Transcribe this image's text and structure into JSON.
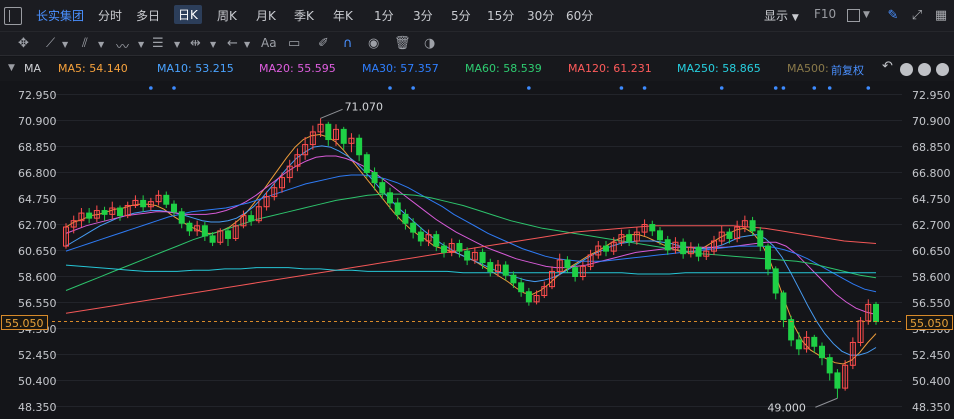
{
  "toolbar": {
    "stock_name": "长实集团",
    "periods": [
      "分时",
      "多日",
      "日K",
      "周K",
      "月K",
      "季K",
      "年K",
      "1分",
      "3分",
      "5分",
      "15分",
      "30分",
      "60分"
    ],
    "active_period": "日K",
    "display_label": "显示",
    "f10_label": "F10"
  },
  "indicator_bar": {
    "name": "MA",
    "items": [
      {
        "label": "MA5: 54.140",
        "color": "#f7a23c"
      },
      {
        "label": "MA10: 53.215",
        "color": "#4aa3ff"
      },
      {
        "label": "MA20: 55.595",
        "color": "#e05ee0"
      },
      {
        "label": "MA30: 57.357",
        "color": "#2f7fff"
      },
      {
        "label": "MA60: 58.539",
        "color": "#2ecc71"
      },
      {
        "label": "MA120: 61.231",
        "color": "#ff5b5b"
      },
      {
        "label": "MA250: 58.865",
        "color": "#27d0e0"
      },
      {
        "label": "MA500:",
        "color": "#8a7a4a"
      }
    ],
    "fuquan_label": "前复权"
  },
  "chart_data": {
    "type": "candlestick",
    "ylim": [
      48.35,
      72.95
    ],
    "y_ticks": [
      "72.950",
      "70.900",
      "68.850",
      "66.800",
      "64.750",
      "62.700",
      "60.650",
      "58.600",
      "56.550",
      "54.500",
      "52.450",
      "50.400",
      "48.350"
    ],
    "current_price": "55.050",
    "max_annotation": "71.070",
    "min_annotation": "49.000",
    "max_value": 71.07,
    "min_value": 49.0,
    "up_color": "#ff4d4d",
    "down_color": "#1fd046",
    "candles": [
      [
        61.0,
        62.5,
        62.8,
        60.8
      ],
      [
        62.5,
        63.0,
        63.4,
        62.0
      ],
      [
        63.0,
        63.6,
        64.0,
        62.5
      ],
      [
        63.6,
        63.2,
        64.0,
        62.8
      ],
      [
        63.2,
        63.8,
        64.2,
        62.9
      ],
      [
        63.8,
        63.5,
        64.1,
        63.0
      ],
      [
        63.5,
        64.0,
        64.5,
        63.1
      ],
      [
        64.0,
        63.4,
        64.2,
        63.0
      ],
      [
        63.4,
        64.2,
        64.5,
        63.2
      ],
      [
        64.2,
        64.6,
        65.0,
        64.0
      ],
      [
        64.6,
        64.1,
        65.0,
        63.7
      ],
      [
        64.1,
        64.5,
        64.8,
        63.8
      ],
      [
        64.5,
        65.0,
        65.4,
        64.2
      ],
      [
        65.0,
        64.3,
        65.3,
        64.0
      ],
      [
        64.3,
        63.7,
        64.6,
        63.4
      ],
      [
        63.7,
        62.8,
        64.0,
        62.4
      ],
      [
        62.8,
        62.2,
        63.0,
        61.8
      ],
      [
        62.2,
        62.6,
        63.0,
        61.8
      ],
      [
        62.6,
        61.8,
        62.9,
        61.4
      ],
      [
        61.8,
        61.3,
        62.1,
        61.0
      ],
      [
        61.3,
        62.2,
        62.4,
        61.1
      ],
      [
        62.2,
        61.6,
        62.5,
        61.0
      ],
      [
        61.6,
        62.6,
        63.0,
        61.4
      ],
      [
        62.6,
        63.4,
        63.8,
        62.4
      ],
      [
        63.4,
        63.0,
        63.8,
        62.6
      ],
      [
        63.0,
        64.1,
        64.6,
        62.8
      ],
      [
        64.1,
        64.9,
        65.3,
        63.8
      ],
      [
        64.9,
        65.6,
        66.0,
        64.6
      ],
      [
        65.6,
        66.4,
        66.8,
        65.2
      ],
      [
        66.4,
        67.3,
        67.8,
        66.0
      ],
      [
        67.3,
        68.2,
        68.7,
        66.9
      ],
      [
        68.2,
        69.0,
        69.6,
        67.8
      ],
      [
        69.0,
        70.0,
        70.5,
        68.6
      ],
      [
        70.0,
        70.6,
        71.07,
        69.6
      ],
      [
        70.6,
        69.4,
        70.8,
        68.9
      ],
      [
        69.4,
        70.2,
        70.6,
        68.9
      ],
      [
        70.2,
        69.1,
        70.4,
        68.6
      ],
      [
        69.1,
        69.5,
        69.9,
        68.4
      ],
      [
        69.5,
        68.2,
        69.8,
        67.7
      ],
      [
        68.2,
        66.8,
        68.4,
        66.4
      ],
      [
        66.8,
        66.0,
        67.2,
        65.4
      ],
      [
        66.0,
        65.2,
        66.4,
        64.7
      ],
      [
        65.2,
        64.4,
        65.6,
        63.9
      ],
      [
        64.4,
        63.5,
        64.8,
        63.1
      ],
      [
        63.5,
        62.8,
        63.9,
        62.3
      ],
      [
        62.8,
        62.1,
        63.2,
        61.6
      ],
      [
        62.1,
        61.4,
        62.5,
        61.0
      ],
      [
        61.4,
        61.9,
        62.3,
        61.0
      ],
      [
        61.9,
        61.0,
        62.2,
        60.6
      ],
      [
        61.0,
        60.5,
        61.3,
        60.1
      ],
      [
        60.5,
        61.2,
        61.6,
        60.2
      ],
      [
        61.2,
        60.6,
        61.5,
        60.1
      ],
      [
        60.6,
        59.9,
        60.9,
        59.5
      ],
      [
        59.9,
        60.5,
        60.9,
        59.6
      ],
      [
        60.5,
        59.7,
        60.8,
        59.2
      ],
      [
        59.7,
        59.0,
        60.0,
        58.6
      ],
      [
        59.0,
        59.5,
        59.9,
        58.6
      ],
      [
        59.5,
        58.7,
        59.8,
        58.3
      ],
      [
        58.7,
        58.1,
        59.0,
        57.7
      ],
      [
        58.1,
        57.4,
        58.5,
        57.0
      ],
      [
        57.4,
        56.6,
        57.7,
        56.3
      ],
      [
        56.6,
        57.1,
        57.5,
        56.4
      ],
      [
        57.1,
        57.8,
        58.2,
        56.9
      ],
      [
        57.8,
        59.0,
        59.4,
        57.6
      ],
      [
        59.0,
        59.9,
        60.4,
        58.7
      ],
      [
        59.9,
        59.3,
        60.2,
        58.9
      ],
      [
        59.3,
        58.6,
        59.6,
        58.2
      ],
      [
        58.6,
        59.4,
        59.8,
        58.3
      ],
      [
        59.4,
        60.3,
        60.7,
        59.1
      ],
      [
        60.3,
        61.0,
        61.4,
        60.0
      ],
      [
        61.0,
        60.6,
        61.4,
        60.2
      ],
      [
        60.6,
        61.3,
        61.7,
        60.3
      ],
      [
        61.3,
        61.9,
        62.3,
        61.0
      ],
      [
        61.9,
        61.4,
        62.3,
        61.0
      ],
      [
        61.4,
        62.1,
        62.5,
        61.1
      ],
      [
        62.1,
        62.7,
        63.1,
        61.8
      ],
      [
        62.7,
        62.2,
        63.0,
        61.8
      ],
      [
        62.2,
        61.5,
        62.5,
        61.1
      ],
      [
        61.5,
        60.7,
        61.8,
        60.3
      ],
      [
        60.7,
        61.3,
        61.7,
        60.4
      ],
      [
        61.3,
        60.4,
        61.6,
        60.0
      ],
      [
        60.4,
        60.9,
        61.3,
        60.1
      ],
      [
        60.9,
        60.2,
        61.2,
        59.8
      ],
      [
        60.2,
        60.6,
        61.0,
        59.9
      ],
      [
        60.6,
        61.4,
        61.8,
        60.3
      ],
      [
        61.4,
        62.1,
        62.6,
        61.1
      ],
      [
        62.1,
        61.6,
        62.4,
        61.2
      ],
      [
        61.6,
        62.5,
        63.0,
        61.3
      ],
      [
        62.5,
        63.0,
        63.4,
        62.1
      ],
      [
        63.0,
        62.2,
        63.3,
        61.8
      ],
      [
        62.2,
        61.0,
        62.5,
        60.6
      ],
      [
        61.0,
        59.2,
        61.2,
        58.7
      ],
      [
        59.2,
        57.3,
        59.4,
        56.8
      ],
      [
        57.3,
        55.2,
        57.5,
        54.6
      ],
      [
        55.2,
        53.6,
        55.5,
        53.1
      ],
      [
        53.6,
        52.9,
        54.2,
        52.4
      ],
      [
        52.9,
        53.8,
        54.3,
        52.6
      ],
      [
        53.8,
        53.1,
        54.0,
        52.6
      ],
      [
        53.1,
        52.2,
        53.4,
        51.6
      ],
      [
        52.2,
        51.0,
        52.5,
        50.4
      ],
      [
        51.0,
        49.8,
        51.3,
        49.0
      ],
      [
        49.8,
        51.6,
        52.0,
        49.6
      ],
      [
        51.6,
        53.4,
        53.8,
        51.3
      ],
      [
        53.4,
        55.1,
        55.4,
        53.1
      ],
      [
        55.1,
        56.4,
        56.8,
        54.8
      ],
      [
        56.4,
        55.05,
        56.6,
        54.8
      ]
    ],
    "ma_lines": [
      {
        "name": "MA5",
        "color": "#f7a23c",
        "values": [
          62.5,
          62.9,
          63.1,
          63.4,
          63.5,
          63.7,
          63.9,
          64.0,
          64.2,
          64.3,
          64.3,
          64.2,
          63.9,
          63.4,
          63.0,
          62.6,
          62.3,
          62.0,
          62.0,
          62.2,
          62.5,
          63.0,
          63.6,
          64.4,
          65.3,
          66.2,
          67.1,
          68.0,
          68.8,
          69.4,
          69.7,
          69.8,
          69.6,
          69.2,
          68.5,
          67.7,
          66.9,
          66.1,
          65.3,
          64.5,
          63.7,
          63.0,
          62.4,
          61.9,
          61.5,
          61.0,
          60.8,
          60.6,
          60.4,
          60.1,
          59.8,
          59.4,
          59.0,
          58.6,
          58.2,
          57.7,
          57.3,
          57.2,
          57.5,
          58.0,
          58.6,
          59.1,
          59.5,
          59.9,
          60.3,
          60.6,
          61.0,
          61.4,
          61.7,
          61.9,
          61.9,
          61.7,
          61.4,
          61.1,
          60.8,
          60.6,
          60.5,
          60.6,
          60.9,
          61.3,
          61.7,
          62.0,
          62.3,
          62.4,
          62.0,
          61.2,
          59.9,
          58.2,
          56.4,
          54.7,
          53.5,
          52.8,
          52.4,
          52.1,
          51.8,
          51.7,
          52.0,
          52.6,
          53.4,
          54.1
        ]
      },
      {
        "name": "MA10",
        "color": "#4aa3ff",
        "values": [
          61.0,
          61.4,
          61.8,
          62.2,
          62.6,
          62.9,
          63.2,
          63.4,
          63.6,
          63.7,
          63.8,
          63.8,
          63.7,
          63.6,
          63.4,
          63.2,
          63.0,
          62.9,
          62.9,
          63.0,
          63.2,
          63.6,
          64.1,
          64.8,
          65.6,
          66.4,
          67.2,
          67.9,
          68.4,
          68.8,
          68.9,
          68.8,
          68.5,
          68.1,
          67.6,
          66.9,
          66.2,
          65.4,
          64.7,
          64.0,
          63.4,
          62.8,
          62.2,
          61.7,
          61.2,
          60.8,
          60.4,
          60.1,
          59.8,
          59.5,
          59.2,
          58.9,
          58.7,
          58.5,
          58.3,
          58.2,
          58.3,
          58.5,
          58.8,
          59.2,
          59.6,
          60.0,
          60.4,
          60.7,
          61.0,
          61.2,
          61.3,
          61.4,
          61.4,
          61.4,
          61.3,
          61.2,
          61.0,
          60.9,
          60.8,
          60.8,
          60.9,
          61.1,
          61.4,
          61.7,
          61.8,
          61.9,
          61.6,
          61.0,
          60.1,
          58.9,
          57.6,
          56.3,
          55.1,
          54.1,
          53.3,
          52.7,
          52.4,
          52.4,
          52.6,
          53.0
        ]
      },
      {
        "name": "MA20",
        "color": "#e05ee0",
        "values": [
          62.0,
          62.3,
          62.6,
          62.8,
          63.0,
          63.2,
          63.4,
          63.5,
          63.6,
          63.7,
          63.7,
          63.6,
          63.5,
          63.5,
          63.5,
          63.6,
          63.8,
          64.1,
          64.5,
          65.0,
          65.6,
          66.2,
          66.8,
          67.3,
          67.7,
          68.0,
          68.1,
          68.1,
          67.9,
          67.6,
          67.2,
          66.7,
          66.1,
          65.5,
          64.9,
          64.3,
          63.7,
          63.1,
          62.6,
          62.1,
          61.7,
          61.3,
          60.9,
          60.6,
          60.3,
          60.0,
          59.8,
          59.6,
          59.4,
          59.3,
          59.3,
          59.4,
          59.5,
          59.7,
          59.9,
          60.1,
          60.3,
          60.5,
          60.6,
          60.7,
          60.8,
          60.9,
          60.9,
          60.9,
          60.9,
          60.9,
          60.9,
          61.0,
          61.1,
          61.2,
          61.3,
          61.3,
          61.0,
          60.4,
          59.6,
          58.8,
          58.0,
          57.2,
          56.6,
          56.1,
          55.8,
          55.6
        ]
      },
      {
        "name": "MA30",
        "color": "#2f7fff",
        "values": [
          60.6,
          60.9,
          61.2,
          61.5,
          61.8,
          62.1,
          62.4,
          62.7,
          63.0,
          63.3,
          63.5,
          63.7,
          63.8,
          63.9,
          64.0,
          64.2,
          64.4,
          64.7,
          65.0,
          65.3,
          65.6,
          65.9,
          66.1,
          66.3,
          66.5,
          66.6,
          66.6,
          66.5,
          66.3,
          66.0,
          65.6,
          65.1,
          64.6,
          64.1,
          63.5,
          63.0,
          62.5,
          62.0,
          61.6,
          61.2,
          60.8,
          60.5,
          60.2,
          60.0,
          59.9,
          59.8,
          59.8,
          59.8,
          59.9,
          60.0,
          60.1,
          60.2,
          60.3,
          60.4,
          60.5,
          60.6,
          60.7,
          60.8,
          60.9,
          61.0,
          61.0,
          61.0,
          60.9,
          60.7,
          60.4,
          60.0,
          59.5,
          59.0,
          58.5,
          58.0,
          57.6,
          57.4
        ]
      },
      {
        "name": "MA60",
        "color": "#2ecc71",
        "values": [
          57.5,
          58.0,
          58.5,
          59.0,
          59.5,
          60.0,
          60.5,
          61.0,
          61.5,
          61.9,
          62.3,
          62.7,
          63.1,
          63.4,
          63.7,
          64.0,
          64.3,
          64.6,
          64.8,
          65.0,
          65.1,
          65.1,
          65.0,
          64.8,
          64.5,
          64.2,
          63.8,
          63.4,
          63.0,
          62.7,
          62.4,
          62.2,
          62.0,
          61.8,
          61.6,
          61.4,
          61.2,
          61.0,
          60.8,
          60.6,
          60.4,
          60.3,
          60.2,
          60.1,
          60.0,
          59.9,
          59.8,
          59.6,
          59.3,
          59.0,
          58.7,
          58.5
        ]
      },
      {
        "name": "MA120",
        "color": "#ff5b5b",
        "values": [
          55.7,
          55.9,
          56.1,
          56.3,
          56.5,
          56.7,
          56.9,
          57.1,
          57.3,
          57.5,
          57.7,
          57.9,
          58.1,
          58.3,
          58.5,
          58.7,
          58.9,
          59.1,
          59.3,
          59.5,
          59.7,
          59.9,
          60.1,
          60.3,
          60.5,
          60.7,
          60.9,
          61.1,
          61.3,
          61.5,
          61.7,
          61.9,
          62.1,
          62.2,
          62.3,
          62.4,
          62.5,
          62.6,
          62.6,
          62.6,
          62.6,
          62.6,
          62.6,
          62.5,
          62.4,
          62.2,
          62.0,
          61.8,
          61.6,
          61.4,
          61.3,
          61.2
        ]
      },
      {
        "name": "MA250",
        "color": "#27d0e0",
        "values": [
          59.5,
          59.4,
          59.3,
          59.2,
          59.1,
          59.0,
          59.0,
          59.0,
          59.1,
          59.1,
          59.2,
          59.2,
          59.3,
          59.3,
          59.3,
          59.2,
          59.2,
          59.1,
          59.1,
          59.0,
          59.0,
          59.0,
          59.0,
          59.0,
          59.0,
          58.9,
          58.9,
          58.9,
          58.9,
          58.9,
          58.9,
          58.9,
          58.9,
          58.9,
          58.9,
          58.9,
          58.8,
          58.8,
          58.8,
          58.9,
          58.9,
          58.9,
          58.9,
          58.9,
          58.9,
          58.9,
          58.9,
          58.9,
          58.9,
          58.9,
          58.9,
          58.9
        ]
      }
    ]
  }
}
